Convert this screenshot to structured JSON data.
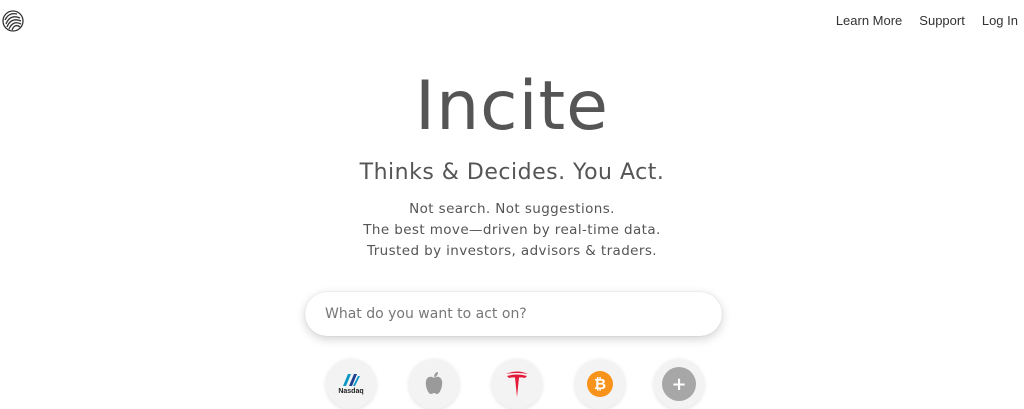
{
  "nav": {
    "logo_icon": "fingerprint-icon",
    "links": [
      {
        "label": "Learn More"
      },
      {
        "label": "Support"
      },
      {
        "label": "Log In"
      }
    ]
  },
  "hero": {
    "title": "Incite",
    "tagline": "Thinks & Decides. You Act.",
    "lines": [
      "Not search. Not suggestions.",
      "The best move—driven by real-time data.",
      "Trusted by investors, advisors & traders."
    ]
  },
  "search": {
    "placeholder": "What do you want to act on?"
  },
  "quick_actions": [
    {
      "name": "Nasdaq",
      "icon": "nasdaq-icon",
      "label": "Nasdaq"
    },
    {
      "name": "Apple",
      "icon": "apple-icon"
    },
    {
      "name": "Tesla",
      "icon": "tesla-icon"
    },
    {
      "name": "Bitcoin",
      "icon": "bitcoin-icon",
      "glyph": "₿"
    },
    {
      "name": "Add",
      "icon": "plus-icon",
      "glyph": "+"
    }
  ],
  "colors": {
    "text": "#555555",
    "bitcoin": "#f7931a",
    "tesla": "#e31937",
    "nasdaq": "#0996c7"
  }
}
